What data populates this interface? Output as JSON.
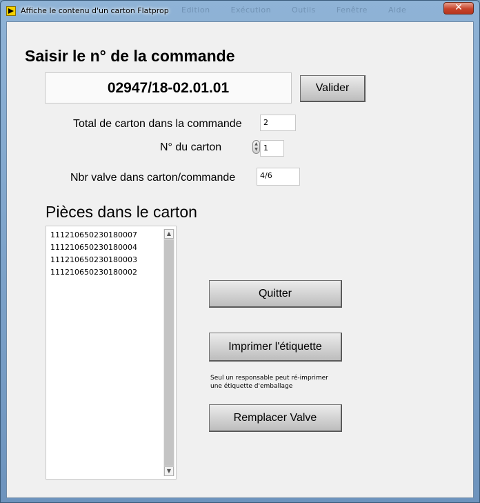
{
  "window": {
    "title": "Affiche le contenu d'un carton Flatprop",
    "ghost_menu": [
      "Edition",
      "Exécution",
      "Outils",
      "Fenêtre",
      "Aide"
    ],
    "close_label": "✕"
  },
  "order": {
    "heading": "Saisir le n° de la commande",
    "number": "02947/18-02.01.01",
    "validate_label": "Valider"
  },
  "fields": {
    "total_label": "Total de carton dans la commande",
    "total_value": "2",
    "carton_no_label": "N° du carton",
    "carton_no_value": "1",
    "valve_label": "Nbr valve dans carton/commande",
    "valve_value": "4/6"
  },
  "pieces": {
    "title": "Pièces dans le carton",
    "items": [
      "111210650230180007",
      "111210650230180004",
      "111210650230180003",
      "111210650230180002"
    ]
  },
  "actions": {
    "quit_label": "Quitter",
    "print_label": "Imprimer l'étiquette",
    "note_line1": "Seul un responsable peut ré-imprimer",
    "note_line2": "une étiquette d'emballage",
    "replace_label": "Remplacer Valve"
  },
  "icons": {
    "app": "labview-run-icon",
    "close": "close-icon",
    "spin_up": "arrow-up-icon",
    "spin_down": "arrow-down-icon"
  }
}
